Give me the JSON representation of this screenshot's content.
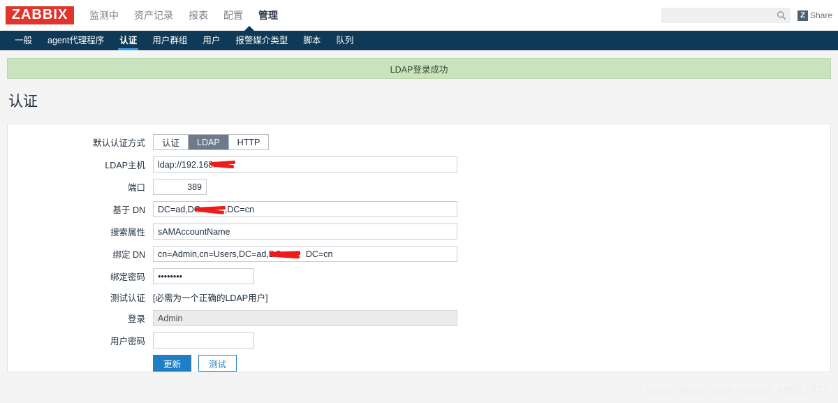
{
  "brand": {
    "logo_text": "ZABBIX"
  },
  "topnav": {
    "items": [
      {
        "label": "监测中",
        "active": false
      },
      {
        "label": "资产记录",
        "active": false
      },
      {
        "label": "报表",
        "active": false
      },
      {
        "label": "配置",
        "active": false
      },
      {
        "label": "管理",
        "active": true
      }
    ]
  },
  "search": {
    "value": "",
    "placeholder": "",
    "icon": "search-icon"
  },
  "share": {
    "badge": "Z",
    "label": "Share"
  },
  "subnav": {
    "items": [
      {
        "label": "一般",
        "active": false
      },
      {
        "label": "agent代理程序",
        "active": false
      },
      {
        "label": "认证",
        "active": true
      },
      {
        "label": "用户群组",
        "active": false
      },
      {
        "label": "用户",
        "active": false
      },
      {
        "label": "报警媒介类型",
        "active": false
      },
      {
        "label": "脚本",
        "active": false
      },
      {
        "label": "队列",
        "active": false
      }
    ]
  },
  "message": {
    "text": "LDAP登录成功",
    "type": "success",
    "color": "#c9e3bf"
  },
  "page": {
    "title": "认证"
  },
  "form": {
    "auth_method": {
      "label": "默认认证方式",
      "options": [
        "认证",
        "LDAP",
        "HTTP"
      ],
      "selected": "LDAP"
    },
    "ldap_host": {
      "label": "LDAP主机",
      "value": "ldap://192.168."
    },
    "port": {
      "label": "端口",
      "value": "389"
    },
    "base_dn": {
      "label": "基于 DN",
      "value_prefix": "DC=ad,DC=",
      "value_suffix": ",DC=cn"
    },
    "search_attribute": {
      "label": "搜索属性",
      "value": "sAMAccountName"
    },
    "bind_dn": {
      "label": "绑定 DN",
      "value_prefix": "cn=Admin,cn=Users,DC=ad,DC=",
      "value_suffix": "DC=cn"
    },
    "bind_password": {
      "label": "绑定密码",
      "value": "••••••••"
    },
    "test_auth": {
      "label": "测试认证",
      "hint": "[必需为一个正确的LDAP用户]"
    },
    "login": {
      "label": "登录",
      "value": "Admin",
      "readonly": true
    },
    "user_password": {
      "label": "用户密码",
      "value": "",
      "placeholder": ""
    },
    "buttons": {
      "update": "更新",
      "test": "测试"
    }
  },
  "watermark": {
    "text": "https://blog.csdn.net/qq_40907977"
  },
  "colors": {
    "brand_red": "#e1342b",
    "subnav_bg": "#0f3a57",
    "accent_blue": "#1f7ec4",
    "success_green": "#c9e3bf",
    "selected_gray": "#6c7a89"
  }
}
